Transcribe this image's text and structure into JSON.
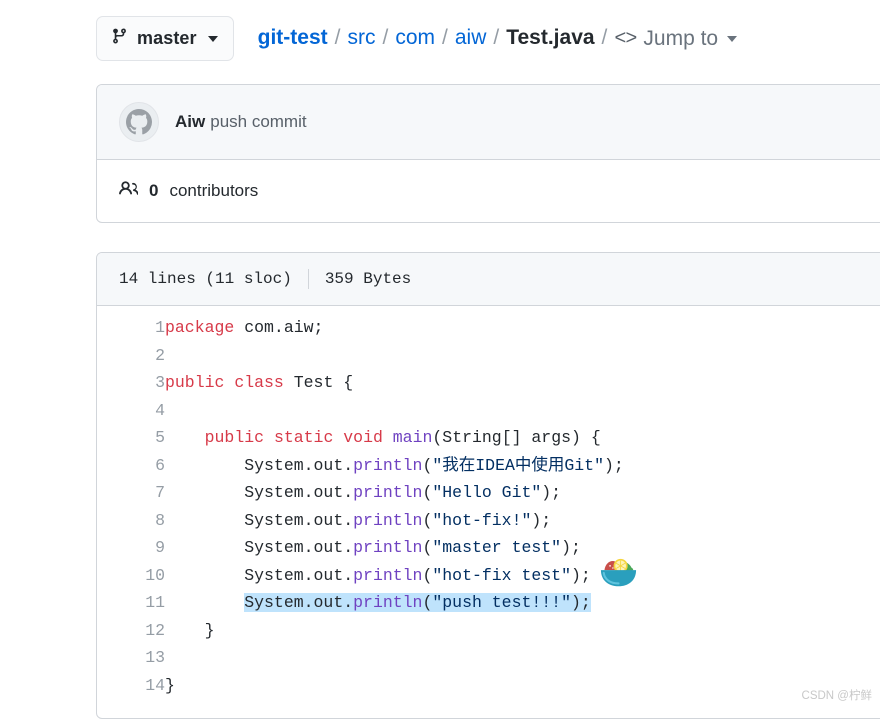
{
  "branch": {
    "icon": "git-branch-icon",
    "name": "master",
    "caret": "chevron-down-icon"
  },
  "breadcrumb": {
    "repo": "git-test",
    "separator": "/",
    "dirs": [
      "src",
      "com",
      "aiw"
    ],
    "file": "Test.java",
    "jump_to": {
      "brackets": "<>",
      "label": "Jump to"
    }
  },
  "commit": {
    "avatar_icon": "github-octocat-avatar",
    "author": "Aiw",
    "message": "push commit"
  },
  "contributors": {
    "icon": "people-icon",
    "count": "0",
    "label": "contributors"
  },
  "file_meta": {
    "lines": "14 lines (11 sloc)",
    "size": "359 Bytes"
  },
  "code": {
    "language": "java",
    "lines": [
      {
        "num": "1",
        "tokens": [
          {
            "t": "package",
            "c": "k"
          },
          {
            "t": " com.aiw;",
            "c": "t"
          }
        ]
      },
      {
        "num": "2",
        "tokens": []
      },
      {
        "num": "3",
        "tokens": [
          {
            "t": "public",
            "c": "k"
          },
          {
            "t": " ",
            "c": "t"
          },
          {
            "t": "class",
            "c": "k"
          },
          {
            "t": " Test {",
            "c": "t"
          }
        ]
      },
      {
        "num": "4",
        "tokens": []
      },
      {
        "num": "5",
        "tokens": [
          {
            "t": "    ",
            "c": "t"
          },
          {
            "t": "public",
            "c": "k"
          },
          {
            "t": " ",
            "c": "t"
          },
          {
            "t": "static",
            "c": "k"
          },
          {
            "t": " ",
            "c": "t"
          },
          {
            "t": "void",
            "c": "k"
          },
          {
            "t": " ",
            "c": "t"
          },
          {
            "t": "main",
            "c": "fn"
          },
          {
            "t": "(String[] args) {",
            "c": "t"
          }
        ]
      },
      {
        "num": "6",
        "tokens": [
          {
            "t": "        System.out.",
            "c": "t"
          },
          {
            "t": "println",
            "c": "fn"
          },
          {
            "t": "(",
            "c": "t"
          },
          {
            "t": "\"我在IDEA中使用Git\"",
            "c": "s"
          },
          {
            "t": ");",
            "c": "t"
          }
        ]
      },
      {
        "num": "7",
        "tokens": [
          {
            "t": "        System.out.",
            "c": "t"
          },
          {
            "t": "println",
            "c": "fn"
          },
          {
            "t": "(",
            "c": "t"
          },
          {
            "t": "\"Hello Git\"",
            "c": "s"
          },
          {
            "t": ");",
            "c": "t"
          }
        ]
      },
      {
        "num": "8",
        "tokens": [
          {
            "t": "        System.out.",
            "c": "t"
          },
          {
            "t": "println",
            "c": "fn"
          },
          {
            "t": "(",
            "c": "t"
          },
          {
            "t": "\"hot-fix!\"",
            "c": "s"
          },
          {
            "t": ");",
            "c": "t"
          }
        ]
      },
      {
        "num": "9",
        "tokens": [
          {
            "t": "        System.out.",
            "c": "t"
          },
          {
            "t": "println",
            "c": "fn"
          },
          {
            "t": "(",
            "c": "t"
          },
          {
            "t": "\"master test\"",
            "c": "s"
          },
          {
            "t": ");",
            "c": "t"
          }
        ]
      },
      {
        "num": "10",
        "tokens": [
          {
            "t": "        System.out.",
            "c": "t"
          },
          {
            "t": "println",
            "c": "fn"
          },
          {
            "t": "(",
            "c": "t"
          },
          {
            "t": "\"hot-fix test\"",
            "c": "s"
          },
          {
            "t": ");",
            "c": "t"
          }
        ]
      },
      {
        "num": "11",
        "selected": true,
        "tokens": [
          {
            "t": "        ",
            "c": "t",
            "nosel": true
          },
          {
            "t": "System.out.",
            "c": "t"
          },
          {
            "t": "println",
            "c": "fn"
          },
          {
            "t": "(",
            "c": "t"
          },
          {
            "t": "\"push test!!!\"",
            "c": "s"
          },
          {
            "t": ");",
            "c": "t"
          }
        ]
      },
      {
        "num": "12",
        "tokens": [
          {
            "t": "    }",
            "c": "t"
          }
        ]
      },
      {
        "num": "13",
        "tokens": []
      },
      {
        "num": "14",
        "tokens": [
          {
            "t": "}",
            "c": "t"
          }
        ]
      }
    ]
  },
  "overlay": {
    "emoji_icon": "green-salad-bowl-emoji"
  },
  "watermark": {
    "text": "CSDN @柠鲜"
  },
  "colors": {
    "link": "#0366d6",
    "keyword": "#d73a49",
    "function": "#6f42c1",
    "string": "#032f62",
    "selection": "#bfe3fc",
    "card_header": "#f6f8fa",
    "border": "#d1d5da"
  }
}
